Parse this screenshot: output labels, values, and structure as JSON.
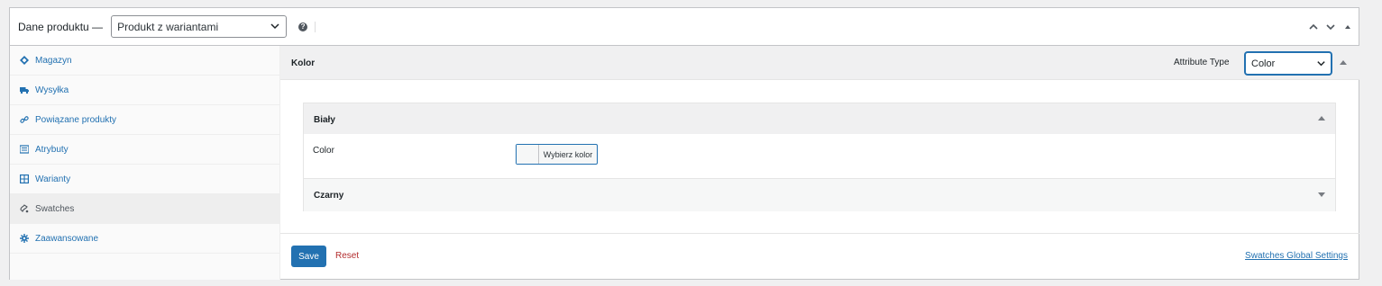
{
  "header": {
    "title": "Dane produktu —",
    "product_type": "Produkt z wariantami",
    "help": "?"
  },
  "tabs": [
    {
      "label": "Magazyn",
      "icon": "inventory-icon"
    },
    {
      "label": "Wysyłka",
      "icon": "truck-icon"
    },
    {
      "label": "Powiązane produkty",
      "icon": "link-icon"
    },
    {
      "label": "Atrybuty",
      "icon": "list-icon"
    },
    {
      "label": "Warianty",
      "icon": "grid-icon"
    },
    {
      "label": "Swatches",
      "icon": "swatch-icon",
      "active": true
    },
    {
      "label": "Zaawansowane",
      "icon": "gear-icon"
    }
  ],
  "attribute": {
    "name": "Kolor",
    "type_label": "Attribute Type",
    "type_value": "Color"
  },
  "terms": [
    {
      "name": "Biały",
      "expanded": true,
      "field_label": "Color",
      "button": "Wybierz kolor"
    },
    {
      "name": "Czarny",
      "expanded": false
    }
  ],
  "footer": {
    "save": "Save",
    "reset": "Reset",
    "global_settings": "Swatches Global Settings"
  },
  "colors": {
    "accent": "#2271b1",
    "danger": "#b32d2e",
    "border": "#c3c4c7"
  }
}
